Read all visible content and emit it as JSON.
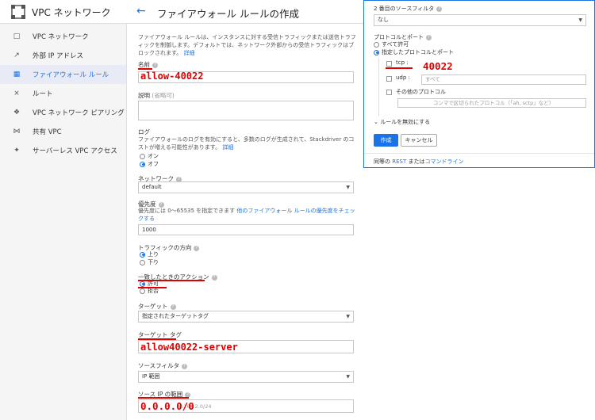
{
  "header": {
    "app_title": "VPC ネットワーク",
    "page_title": "ファイアウォール ルールの作成",
    "back_icon": "arrow-left-icon"
  },
  "sidebar": {
    "items": [
      {
        "icon": "vpc-network-icon",
        "label": "VPC ネットワーク"
      },
      {
        "icon": "external-ip-icon",
        "label": "外部 IP アドレス"
      },
      {
        "icon": "firewall-icon",
        "label": "ファイアウォール ルール",
        "active": true
      },
      {
        "icon": "route-icon",
        "label": "ルート"
      },
      {
        "icon": "peering-icon",
        "label": "VPC ネットワーク ピアリング"
      },
      {
        "icon": "shared-vpc-icon",
        "label": "共有 VPC"
      },
      {
        "icon": "serverless-icon",
        "label": "サーバーレス VPC アクセス"
      }
    ]
  },
  "form": {
    "description_1": "ファイアウォール ルールは、インスタンスに対する受信トラフィックまたは送信トラフィックを制御します。デフォルトでは、ネットワーク外部からの受信トラフィックはブロックされます。",
    "description_link": "詳細",
    "name_label": "名前",
    "name_value": "allow-40022",
    "desc_label": "説明",
    "desc_optional": "(省略可)",
    "log_label": "ログ",
    "log_desc": "ファイアウォールのログを有効にすると、多数のログが生成されて、Stackdriver のコストが増える可能性があります。",
    "log_link": "詳細",
    "log_on": "オン",
    "log_off": "オフ",
    "network_label": "ネットワーク",
    "network_value": "default",
    "priority_label": "優先度",
    "priority_desc": "優先度には 0〜65535 を指定できます",
    "priority_link": "他のファイアウォール ルールの優先度をチェックする",
    "priority_value": "1000",
    "direction_label": "トラフィックの方向",
    "direction_up": "上り",
    "direction_down": "下り",
    "action_label": "一致したときのアクション",
    "action_allow": "許可",
    "action_deny": "拒否",
    "target_label": "ターゲット",
    "target_value": "指定されたターゲットタグ",
    "target_tag_label": "ターゲット タグ",
    "target_tag_value": "allow40022-server",
    "source_filter_label": "ソースフィルタ",
    "source_filter_value": "IP 範囲",
    "source_ip_label": "ソース IP の範囲",
    "source_ip_value": "0.0.0.0/0",
    "source_ip_hint": "2.168.2.0/24"
  },
  "popup": {
    "second_filter_label": "2 番目のソースフィルタ",
    "second_filter_value": "なし",
    "protocol_label": "プロトコルとポート",
    "allow_all": "すべて許可",
    "specified": "指定したプロトコルとポート",
    "tcp_label": "tcp :",
    "tcp_value": "40022",
    "udp_label": "udp :",
    "udp_placeholder": "すべて",
    "other_label": "その他のプロトコル",
    "other_placeholder": "コンマで区切られたプロトコル（「ah, sctp」など）",
    "disable_rule": "ルールを無効にする",
    "create_button": "作成",
    "cancel_button": "キャンセル",
    "equivalent": "同等の",
    "rest_link": "REST",
    "or_text": "または",
    "cli_link": "コマンドライン"
  },
  "colors": {
    "accent": "#1a73e8",
    "annotation": "#e00000"
  }
}
